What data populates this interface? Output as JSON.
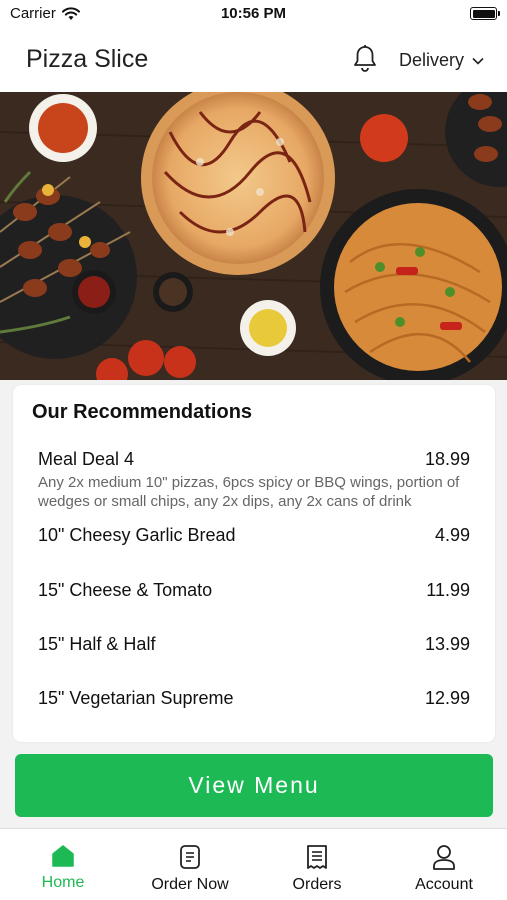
{
  "status_bar": {
    "carrier": "Carrier",
    "time": "10:56 PM"
  },
  "header": {
    "title": "Pizza Slice",
    "delivery_label": "Delivery"
  },
  "recommendations": {
    "title": "Our Recommendations",
    "items": [
      {
        "name": "Meal Deal 4",
        "price": "18.99",
        "description": "Any 2x medium 10\" pizzas, 6pcs spicy or BBQ wings, portion of wedges or small chips, any 2x dips, any 2x cans of drink"
      },
      {
        "name": "10\" Cheesy Garlic Bread",
        "price": "4.99"
      },
      {
        "name": "15\" Cheese & Tomato",
        "price": "11.99"
      },
      {
        "name": "15\" Half & Half",
        "price": "13.99"
      },
      {
        "name": "15\" Vegetarian Supreme",
        "price": "12.99"
      }
    ]
  },
  "view_menu_label": "View Menu",
  "tabs": [
    {
      "label": "Home",
      "icon": "home-icon",
      "active": true
    },
    {
      "label": "Order Now",
      "icon": "order-now-icon",
      "active": false
    },
    {
      "label": "Orders",
      "icon": "receipt-icon",
      "active": false
    },
    {
      "label": "Account",
      "icon": "person-icon",
      "active": false
    }
  ],
  "colors": {
    "accent": "#1db954",
    "text": "#111111",
    "subtext": "#666666"
  }
}
